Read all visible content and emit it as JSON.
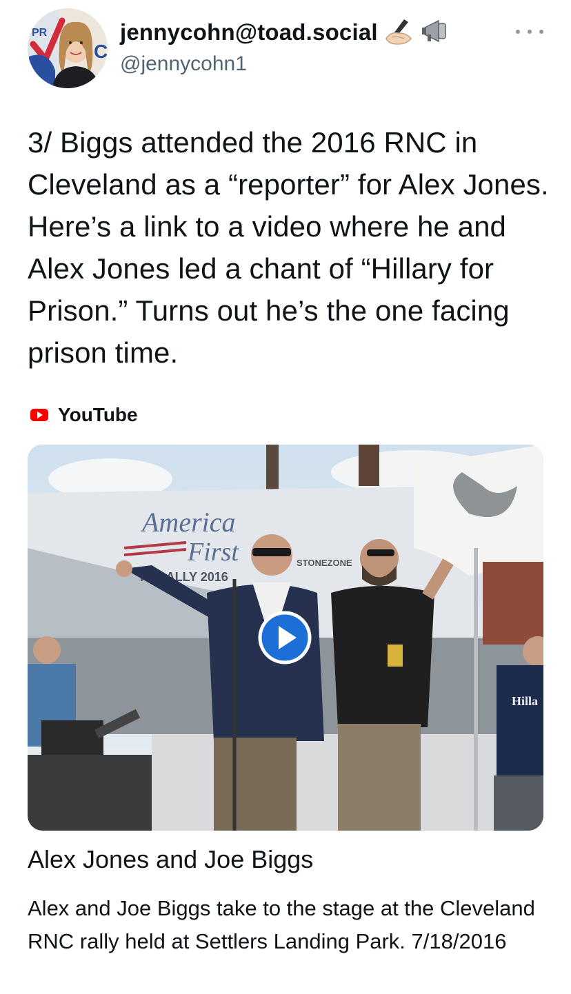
{
  "author": {
    "display_name": "jennycohn@toad.social",
    "handle": "@jennycohn1",
    "badge_emojis": [
      "writing-hand-emoji",
      "megaphone-emoji"
    ],
    "avatar_text_fragments": [
      "PR",
      "C"
    ]
  },
  "tweet": {
    "text": "3/ Biggs attended the 2016 RNC in Cleveland as a “reporter” for Alex Jones. Here’s a link to a video where he and Alex Jones led a chant of “Hillary for Prison.” Turns out he’s the one facing prison time."
  },
  "link_card": {
    "source": "YouTube",
    "title": "Alex Jones and Joe Biggs",
    "description": "Alex and Joe Biggs take to the stage at the Cleveland RNC rally held at Settlers Landing Park. 7/18/2016",
    "thumbnail_text": {
      "banner_line1": "America",
      "banner_line2": "First",
      "banner_line3": "TY RALLY 2016",
      "sign": "STONEZONE",
      "shirt": "Hilla"
    }
  },
  "colors": {
    "text": "#0f1419",
    "secondary": "#536471",
    "youtube_red": "#ff0000",
    "play_blue": "#1d6fd8"
  }
}
